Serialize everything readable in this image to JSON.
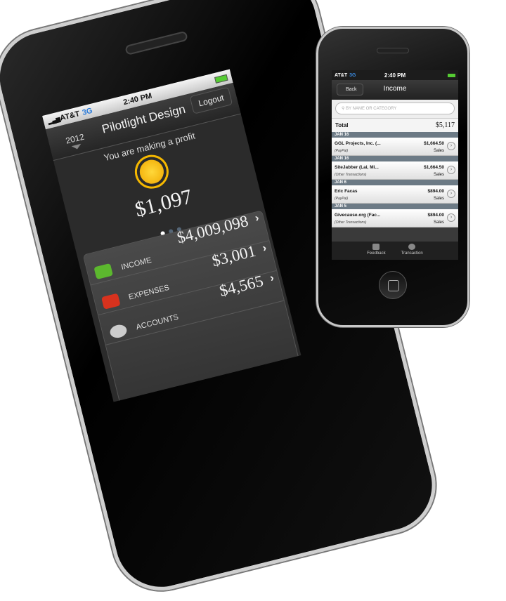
{
  "left_phone": {
    "status": {
      "carrier": "AT&T",
      "network": "3G",
      "time": "2:40 PM"
    },
    "nav": {
      "title": "Pilotlight Design",
      "year": "2012",
      "logout": "Logout"
    },
    "summary": {
      "message": "You are making a profit",
      "icon": "sun-icon",
      "amount": "$1,097",
      "page": 1,
      "pages": 3
    },
    "rows": [
      {
        "label": "INCOME",
        "value": "$4,009,098",
        "icon": "green-arrow-icon",
        "color": "#5cb82e"
      },
      {
        "label": "EXPENSES",
        "value": "$3,001",
        "icon": "red-arrow-icon",
        "color": "#d8321e"
      },
      {
        "label": "ACCOUNTS",
        "value": "$4,565",
        "icon": "money-bag-icon",
        "color": "#ccc"
      }
    ]
  },
  "right_phone": {
    "status": {
      "carrier": "AT&T",
      "network": "3G",
      "time": "2:40 PM"
    },
    "nav": {
      "back": "Back",
      "title": "Income"
    },
    "search": {
      "placeholder": "BY NAME OR CATEGORY"
    },
    "total": {
      "label": "Total",
      "amount": "$5,117"
    },
    "transactions": [
      {
        "date": "JAN 16",
        "name": "GGL Projects, Inc. (...",
        "source": "(PayPal)",
        "amount": "$1,664.50",
        "category": "Sales"
      },
      {
        "date": "JAN 16",
        "name": "SiteJabber (Lai, Mi...",
        "source": "(Other Transactions)",
        "amount": "$1,664.50",
        "category": "Sales"
      },
      {
        "date": "JAN 6",
        "name": "Eric Facas",
        "source": "(PayPal)",
        "amount": "$894.00",
        "category": "Sales"
      },
      {
        "date": "JAN 5",
        "name": "Givecause.org (Fac...",
        "source": "(Other Transactions)",
        "amount": "$894.00",
        "category": "Sales"
      }
    ],
    "tabs": [
      {
        "label": "Feedback",
        "icon": "feedback-icon"
      },
      {
        "label": "Transaction",
        "icon": "add-transaction-icon"
      }
    ]
  }
}
